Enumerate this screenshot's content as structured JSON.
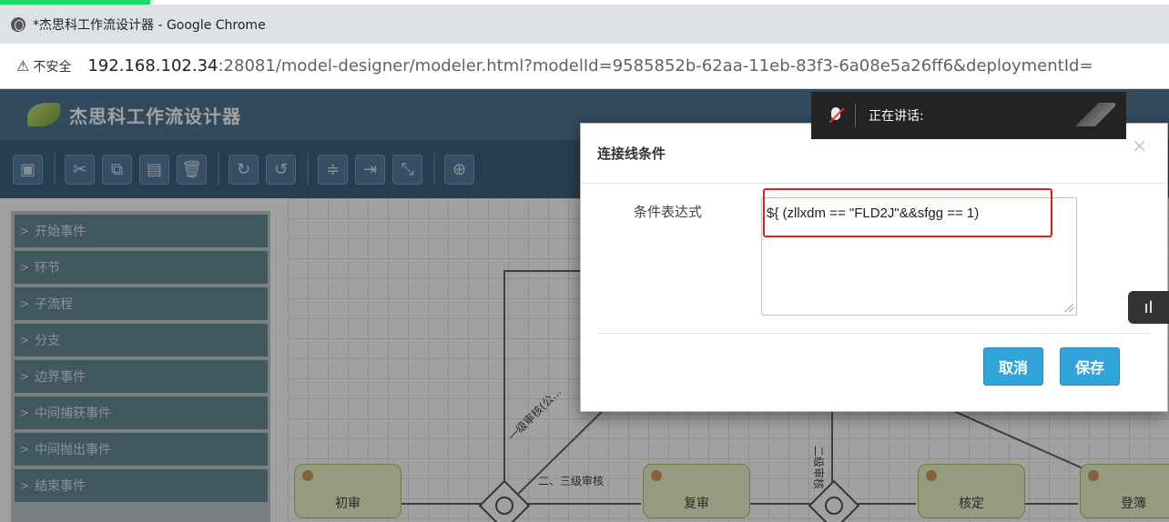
{
  "browser": {
    "window_title": "*杰思科工作流设计器 - Google Chrome",
    "security_label": "不安全",
    "url_host": "192.168.102.34",
    "url_rest": ":28081/model-designer/modeler.html?modelId=9585852b-62aa-11eb-83f3-6a08e5a26ff6&deploymentId="
  },
  "app": {
    "title": "杰思科工作流设计器"
  },
  "palette": {
    "items": [
      "开始事件",
      "环节",
      "子流程",
      "分支",
      "边界事件",
      "中间捕获事件",
      "中间抛出事件",
      "结束事件"
    ]
  },
  "canvas": {
    "tasks": [
      "初审",
      "复审",
      "核定",
      "登簿"
    ],
    "flow_labels": [
      "一级审核(公...",
      "二、三级审核",
      "二级审核"
    ]
  },
  "voice_bar": {
    "text": "正在讲话:"
  },
  "dialog": {
    "title": "连接线条件",
    "close_glyph": "×",
    "field_label": "条件表达式",
    "expression": "${ (zllxdm == \"FLD2J\"&&sfgg == 1)",
    "cancel_label": "取消",
    "save_label": "保存"
  },
  "side_tab": {
    "icon": "bar-chart-icon",
    "glyph": "ıl"
  },
  "colors": {
    "header": "#3f6a8c",
    "toolbar": "#2f5574",
    "button": "#31a4d9",
    "highlight": "#e02020",
    "task_fill": "#eaf4c3"
  }
}
